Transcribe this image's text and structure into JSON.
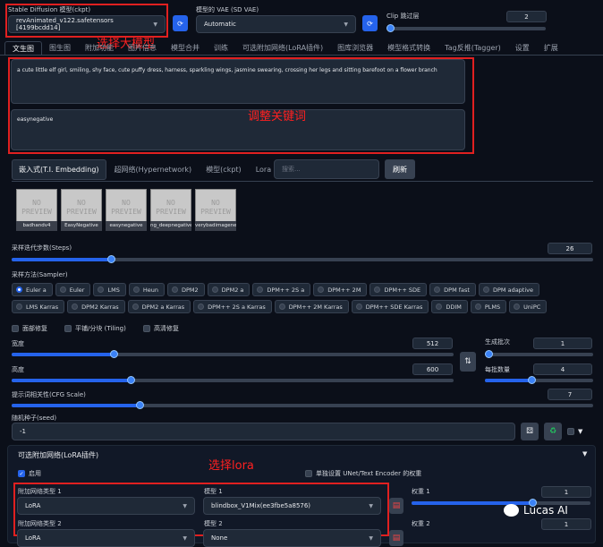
{
  "top": {
    "model_label": "Stable Diffusion 模型(ckpt)",
    "model_value": "revAnimated_v122.safetensors [4199bcdd14]",
    "vae_label": "模型的 VAE (SD VAE)",
    "vae_value": "Automatic",
    "clip_label": "Clip 跳过层",
    "clip_value": "2",
    "annotation_model": "选择大模型"
  },
  "tabs": [
    "文生图",
    "图生图",
    "附加功能",
    "图片信息",
    "模型合并",
    "训练",
    "可选附加网络(LoRA插件)",
    "图库浏览器",
    "模型格式转换",
    "Tag反推(Tagger)",
    "设置",
    "扩展"
  ],
  "prompt": {
    "positive": "a cute little elf girl, smiling, shy face, cute puffy dress, harness, sparkling wings, jasmine swearing, crossing her legs and sitting barefoot on a flower branch",
    "negative": "easynegative",
    "annotation": "调整关键词"
  },
  "extra_tabs": {
    "items": [
      "嵌入式(T.I. Embedding)",
      "超网络(Hypernetwork)",
      "模型(ckpt)",
      "Lora"
    ],
    "search_placeholder": "搜索...",
    "refresh_label": "刷新"
  },
  "embeddings": [
    {
      "thumb": "NO PREVIEW",
      "name": "badhandv4"
    },
    {
      "thumb": "NO PREVIEW",
      "name": "EasyNegative"
    },
    {
      "thumb": "NO PREVIEW",
      "name": "easynegative"
    },
    {
      "thumb": "NO PREVIEW",
      "name": "ng_deepnegative_v1_75t"
    },
    {
      "thumb": "NO PREVIEW",
      "name": "verybadimagenegative"
    }
  ],
  "steps": {
    "label": "采样迭代步数(Steps)",
    "value": "26",
    "fraction": 0.17
  },
  "sampler": {
    "label": "采样方法(Sampler)",
    "selected": "Euler a",
    "options": [
      "Euler a",
      "Euler",
      "LMS",
      "Heun",
      "DPM2",
      "DPM2 a",
      "DPM++ 2S a",
      "DPM++ 2M",
      "DPM++ SDE",
      "DPM fast",
      "DPM adaptive",
      "LMS Karras",
      "DPM2 Karras",
      "DPM2 a Karras",
      "DPM++ 2S a Karras",
      "DPM++ 2M Karras",
      "DPM++ SDE Karras",
      "DDIM",
      "PLMS",
      "UniPC"
    ]
  },
  "checks": {
    "face": "面部修复",
    "tiling": "平铺/分块 (Tiling)",
    "hires": "高清修复"
  },
  "width": {
    "label": "宽度",
    "value": "512",
    "fraction": 0.23
  },
  "height": {
    "label": "高度",
    "value": "600",
    "fraction": 0.27
  },
  "batch_count": {
    "label": "生成批次",
    "value": "1",
    "fraction": 0.0
  },
  "batch_size": {
    "label": "每批数量",
    "value": "4",
    "fraction": 0.43
  },
  "cfg": {
    "label": "提示词相关性(CFG Scale)",
    "value": "7",
    "fraction": 0.22
  },
  "seed": {
    "label": "随机种子(seed)",
    "value": "-1"
  },
  "lora_panel": {
    "title": "可选附加网络(LoRA插件)",
    "enable_label": "启用",
    "separate_label": "单独设置 UNet/Text Encoder 的权重",
    "annotation": "选择lora",
    "type1_label": "附加网络类型 1",
    "type1_value": "LoRA",
    "model1_label": "模型 1",
    "model1_value": "blindbox_V1Mix(ee3fbe5a8576)",
    "weight1_label": "权重 1",
    "weight1_value": "1",
    "type2_label": "附加网络类型 2",
    "type2_value": "LoRA",
    "model2_label": "模型 2",
    "model2_value": "None",
    "weight2_label": "权重 2",
    "weight2_value": "1"
  },
  "watermark": "Lucas AI",
  "colors": {
    "accent": "#2563eb",
    "background": "#0b0f19",
    "annotation": "#e02020"
  }
}
